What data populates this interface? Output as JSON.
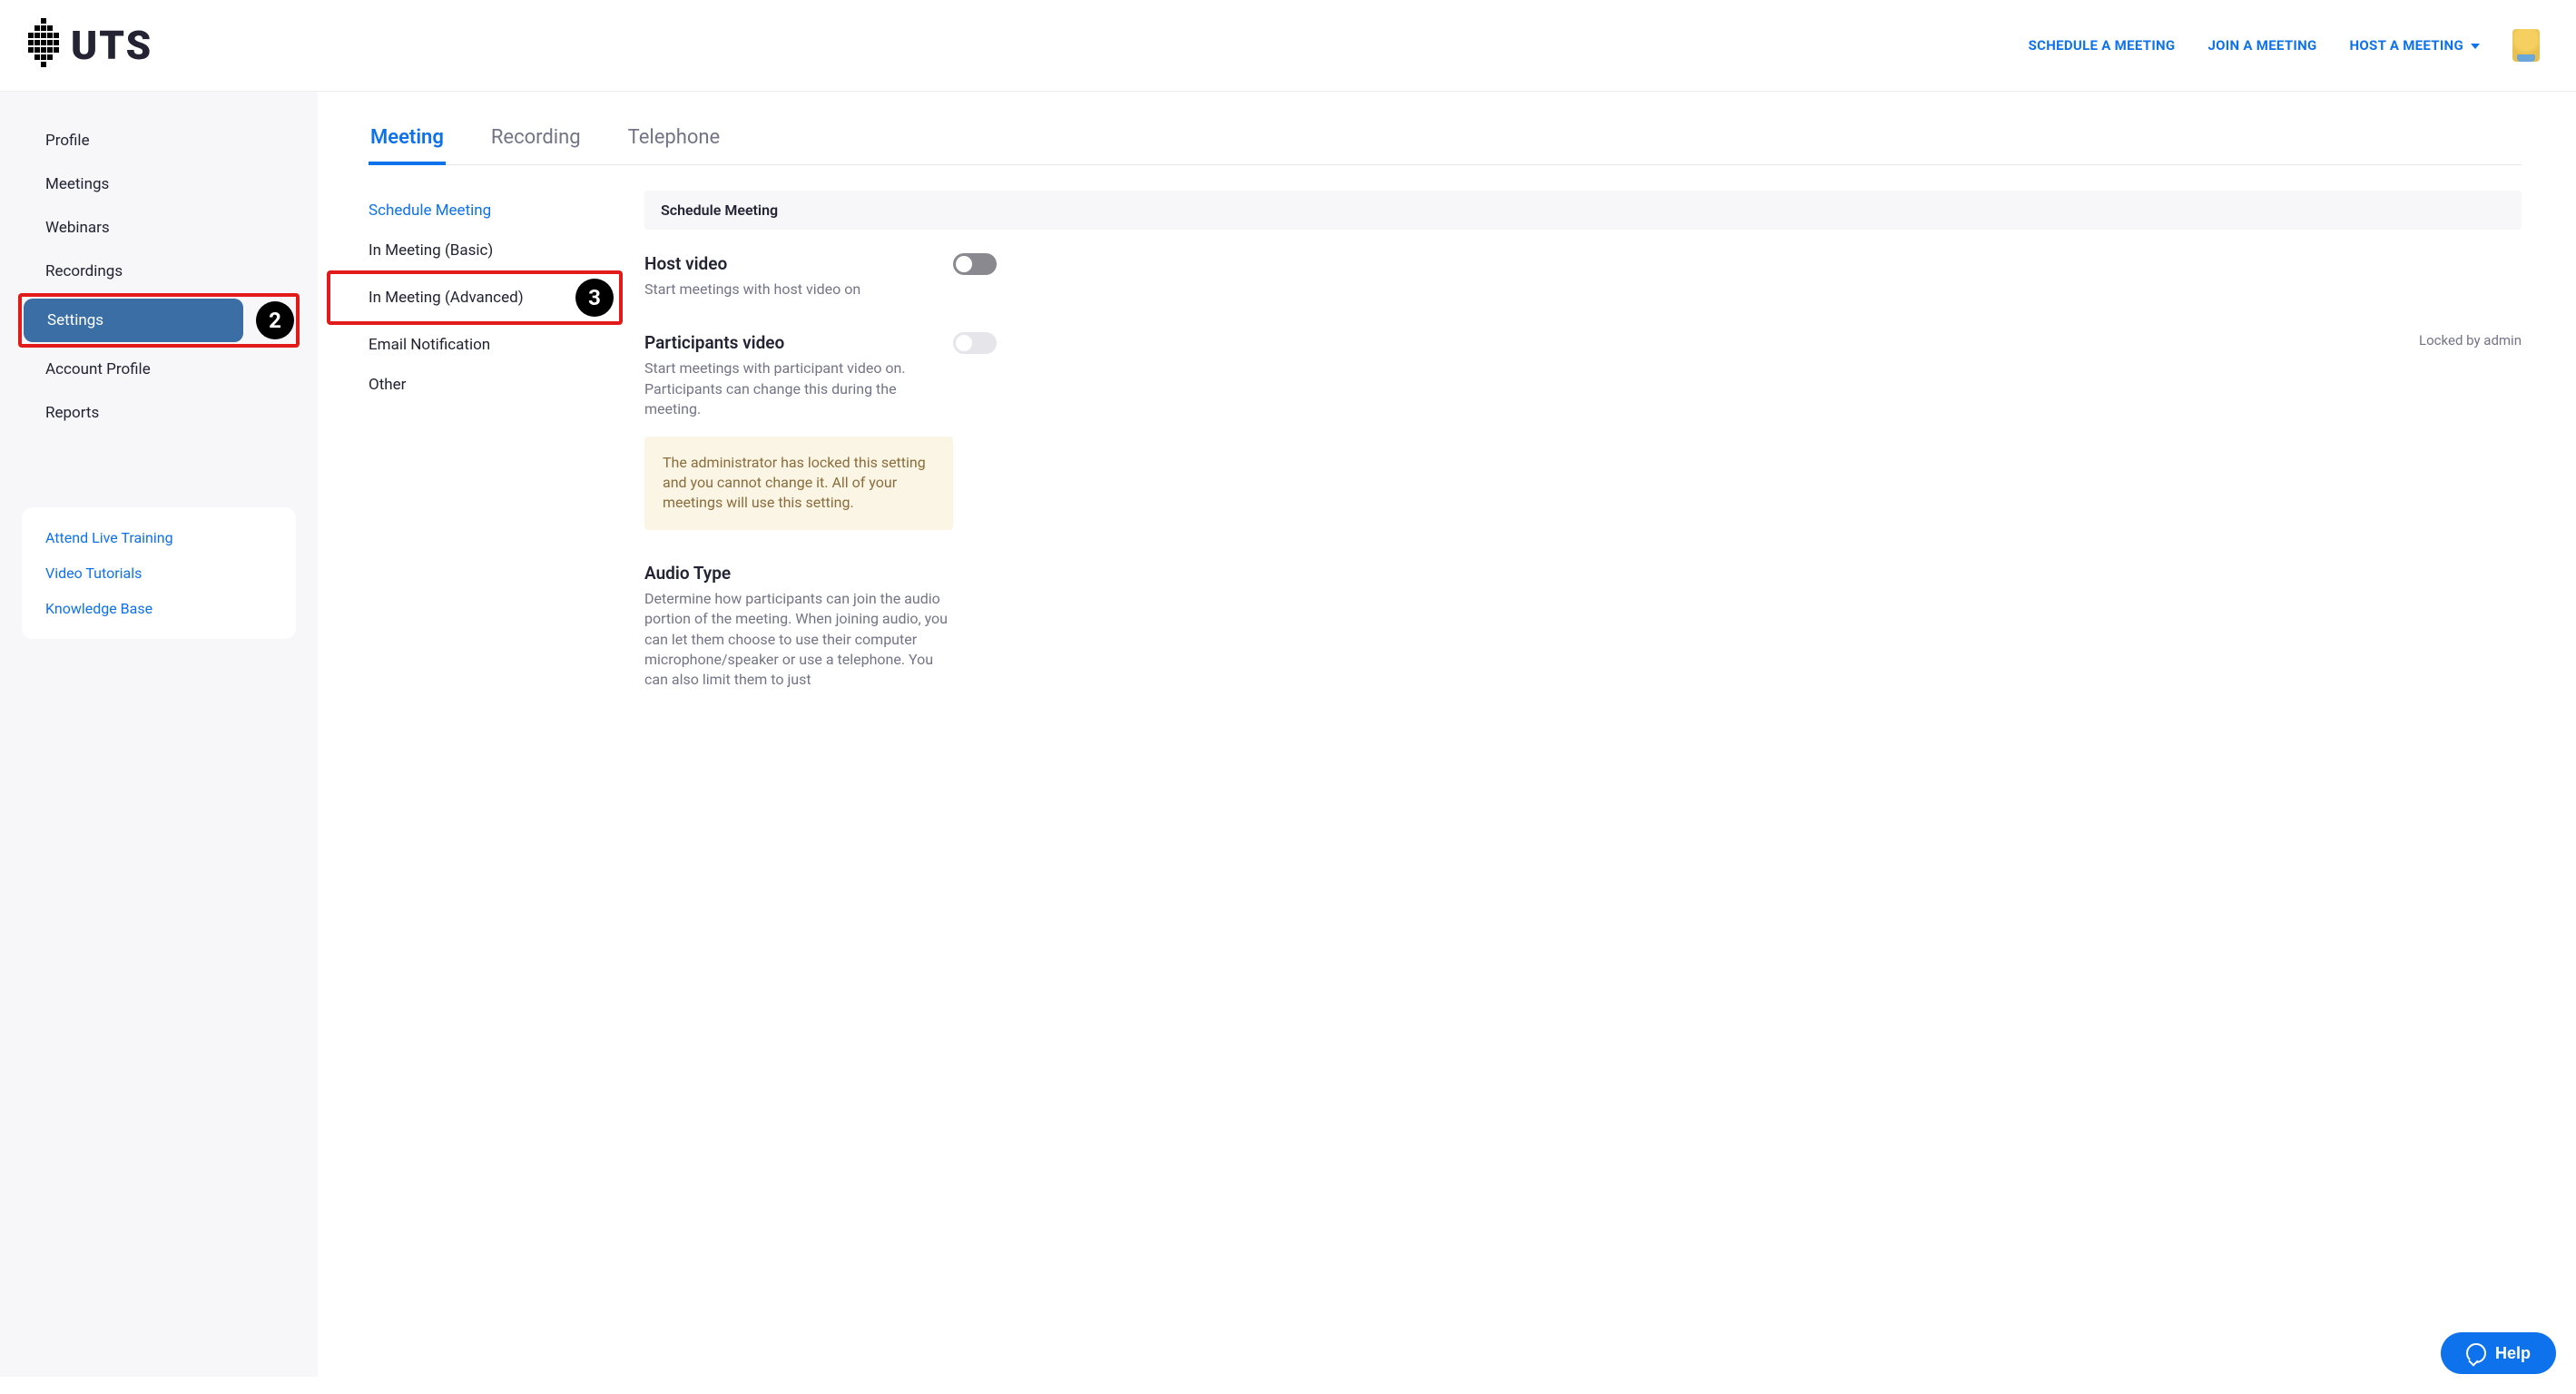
{
  "logo_text": "UTS",
  "header_nav": {
    "schedule": "SCHEDULE A MEETING",
    "join": "JOIN A MEETING",
    "host": "HOST A MEETING"
  },
  "sidebar": {
    "profile": "Profile",
    "meetings": "Meetings",
    "webinars": "Webinars",
    "recordings": "Recordings",
    "settings": "Settings",
    "account_profile": "Account Profile",
    "reports": "Reports",
    "step2_badge": "2"
  },
  "help_links": {
    "training": "Attend Live Training",
    "tutorials": "Video Tutorials",
    "kb": "Knowledge Base"
  },
  "tabs": {
    "meeting": "Meeting",
    "recording": "Recording",
    "telephone": "Telephone"
  },
  "subnav": {
    "schedule": "Schedule Meeting",
    "basic": "In Meeting (Basic)",
    "advanced": "In Meeting (Advanced)",
    "email": "Email Notification",
    "other": "Other",
    "step3_badge": "3"
  },
  "section_header": "Schedule Meeting",
  "settings": {
    "host_video": {
      "title": "Host video",
      "desc": "Start meetings with host video on"
    },
    "participants_video": {
      "title": "Participants video",
      "desc": "Start meetings with participant video on. Participants can change this during the meeting.",
      "locked_label": "Locked by admin",
      "locked_note": "The administrator has locked this setting and you cannot change it. All of your meetings will use this setting."
    },
    "audio_type": {
      "title": "Audio Type",
      "desc": "Determine how participants can join the audio portion of the meeting. When joining audio, you can let them choose to use their computer microphone/speaker or use a telephone. You can also limit them to just"
    }
  },
  "help_button": "Help"
}
